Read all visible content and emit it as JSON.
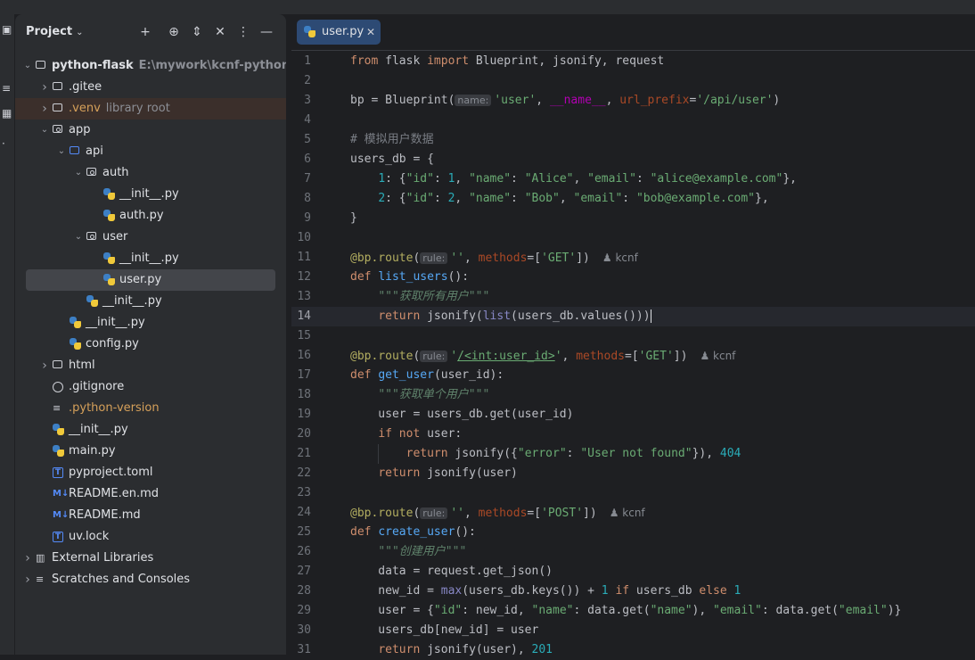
{
  "project_panel": {
    "title": "Project",
    "tree": [
      {
        "label": "python-flask",
        "hint": "E:\\mywork\\kcnf-python\\python",
        "depth": 0,
        "arrow": "open",
        "icon": "module-folder",
        "bold": true
      },
      {
        "label": ".gitee",
        "depth": 1,
        "arrow": "closed",
        "icon": "folder"
      },
      {
        "label": ".venv",
        "hint": "library root",
        "depth": 1,
        "arrow": "closed",
        "icon": "folder",
        "orange": true,
        "highlight": true
      },
      {
        "label": "app",
        "depth": 1,
        "arrow": "open",
        "icon": "package"
      },
      {
        "label": "api",
        "depth": 2,
        "arrow": "open",
        "icon": "folder-blue"
      },
      {
        "label": "auth",
        "depth": 3,
        "arrow": "open",
        "icon": "package"
      },
      {
        "label": "__init__.py",
        "depth": 4,
        "icon": "python"
      },
      {
        "label": "auth.py",
        "depth": 4,
        "icon": "python"
      },
      {
        "label": "user",
        "depth": 3,
        "arrow": "open",
        "icon": "package"
      },
      {
        "label": "__init__.py",
        "depth": 4,
        "icon": "python"
      },
      {
        "label": "user.py",
        "depth": 4,
        "icon": "python",
        "selected": true
      },
      {
        "label": "__init__.py",
        "depth": 3,
        "icon": "python"
      },
      {
        "label": "__init__.py",
        "depth": 2,
        "icon": "python"
      },
      {
        "label": "config.py",
        "depth": 2,
        "icon": "python"
      },
      {
        "label": "html",
        "depth": 1,
        "arrow": "closed",
        "icon": "folder"
      },
      {
        "label": ".gitignore",
        "depth": 1,
        "icon": "ignore"
      },
      {
        "label": ".python-version",
        "depth": 1,
        "icon": "text",
        "orange": true
      },
      {
        "label": "__init__.py",
        "depth": 1,
        "icon": "python"
      },
      {
        "label": "main.py",
        "depth": 1,
        "icon": "python"
      },
      {
        "label": "pyproject.toml",
        "depth": 1,
        "icon": "toml"
      },
      {
        "label": "README.en.md",
        "depth": 1,
        "icon": "markdown"
      },
      {
        "label": "README.md",
        "depth": 1,
        "icon": "markdown"
      },
      {
        "label": "uv.lock",
        "depth": 1,
        "icon": "toml"
      },
      {
        "label": "External Libraries",
        "depth": 0,
        "arrow": "closed",
        "icon": "library"
      },
      {
        "label": "Scratches and Consoles",
        "depth": 0,
        "arrow": "closed",
        "icon": "scratches"
      }
    ]
  },
  "editor": {
    "tab": {
      "label": "user.py",
      "close": "✕"
    },
    "current_line": 14,
    "lines": [
      {
        "n": "1",
        "h": "<span class=\"kw\">from</span> flask <span class=\"kw\">import</span> Blueprint, jsonify, request"
      },
      {
        "n": "2",
        "h": ""
      },
      {
        "n": "3",
        "h": "bp = Blueprint(<span class=\"inlay\">name:</span><span class=\"str\">'user'</span>, <span class=\"dund\">__name__</span>, <span class=\"prm\">url_prefix</span>=<span class=\"str\">'/api/user'</span>)"
      },
      {
        "n": "4",
        "h": ""
      },
      {
        "n": "5",
        "h": "<span class=\"cm\"># 模拟用户数据</span>"
      },
      {
        "n": "6",
        "h": "users_db = {"
      },
      {
        "n": "7",
        "h": "    <span class=\"num\">1</span>: {<span class=\"str\">\"id\"</span>: <span class=\"num\">1</span>, <span class=\"str\">\"name\"</span>: <span class=\"str\">\"Alice\"</span>, <span class=\"str\">\"email\"</span>: <span class=\"str\">\"alice@example.com\"</span>},"
      },
      {
        "n": "8",
        "h": "    <span class=\"num\">2</span>: {<span class=\"str\">\"id\"</span>: <span class=\"num\">2</span>, <span class=\"str\">\"name\"</span>: <span class=\"str\">\"Bob\"</span>, <span class=\"str\">\"email\"</span>: <span class=\"str\">\"bob@example.com\"</span>},"
      },
      {
        "n": "9",
        "h": "}"
      },
      {
        "n": "10",
        "h": ""
      },
      {
        "n": "11",
        "h": "<span class=\"deco\">@bp.route</span>(<span class=\"inlay\">rule:</span><span class=\"str\">''</span>, <span class=\"prm\">methods</span>=[<span class=\"str\">'GET'</span>])<span class=\"author\">&#9823; kcnf</span>"
      },
      {
        "n": "12",
        "h": "<span class=\"kw\">def</span> <span class=\"fn\">list_users</span>():"
      },
      {
        "n": "13",
        "h": "    <span class=\"doc\">\"\"\"获取所有用户\"\"\"</span>"
      },
      {
        "n": "14",
        "h": "    <span class=\"kw\">return</span> jsonify(<span class=\"bi\">list</span>(users_db.values())<span class=\"caret\">)</span>"
      },
      {
        "n": "15",
        "h": ""
      },
      {
        "n": "16",
        "h": "<span class=\"deco\">@bp.route</span>(<span class=\"inlay\">rule:</span><span class=\"str\">'<span class=\"ul\">/&lt;int:user_id&gt;</span>'</span>, <span class=\"prm\">methods</span>=[<span class=\"str\">'GET'</span>])<span class=\"author\">&#9823; kcnf</span>"
      },
      {
        "n": "17",
        "h": "<span class=\"kw\">def</span> <span class=\"fn\">get_user</span>(user_id):"
      },
      {
        "n": "18",
        "h": "    <span class=\"doc\">\"\"\"获取单个用户\"\"\"</span>"
      },
      {
        "n": "19",
        "h": "    user = users_db.get(user_id)"
      },
      {
        "n": "20",
        "h": "    <span class=\"kw\">if not</span> user:"
      },
      {
        "n": "21",
        "h": "        <span class=\"kw\">return</span> jsonify({<span class=\"str\">\"error\"</span>: <span class=\"str\">\"User not found\"</span>}), <span class=\"num\">404</span>"
      },
      {
        "n": "22",
        "h": "    <span class=\"kw\">return</span> jsonify(user)"
      },
      {
        "n": "23",
        "h": ""
      },
      {
        "n": "24",
        "h": "<span class=\"deco\">@bp.route</span>(<span class=\"inlay\">rule:</span><span class=\"str\">''</span>, <span class=\"prm\">methods</span>=[<span class=\"str\">'POST'</span>])<span class=\"author\">&#9823; kcnf</span>"
      },
      {
        "n": "25",
        "h": "<span class=\"kw\">def</span> <span class=\"fn\">create_user</span>():"
      },
      {
        "n": "26",
        "h": "    <span class=\"doc\">\"\"\"创建用户\"\"\"</span>"
      },
      {
        "n": "27",
        "h": "    data = request.get_json()"
      },
      {
        "n": "28",
        "h": "    new_id = <span class=\"bi\">max</span>(users_db.keys()) + <span class=\"num\">1</span> <span class=\"kw\">if</span> users_db <span class=\"kw\">else</span> <span class=\"num\">1</span>"
      },
      {
        "n": "29",
        "h": "    user = {<span class=\"str\">\"id\"</span>: new_id, <span class=\"str\">\"name\"</span>: data.get(<span class=\"str\">\"name\"</span>), <span class=\"str\">\"email\"</span>: data.get(<span class=\"str\">\"email\"</span>)}"
      },
      {
        "n": "30",
        "h": "    users_db[new_id] = user"
      },
      {
        "n": "31",
        "h": "    <span class=\"kw\">return</span> jsonify(user), <span class=\"num\">201</span>"
      }
    ]
  }
}
